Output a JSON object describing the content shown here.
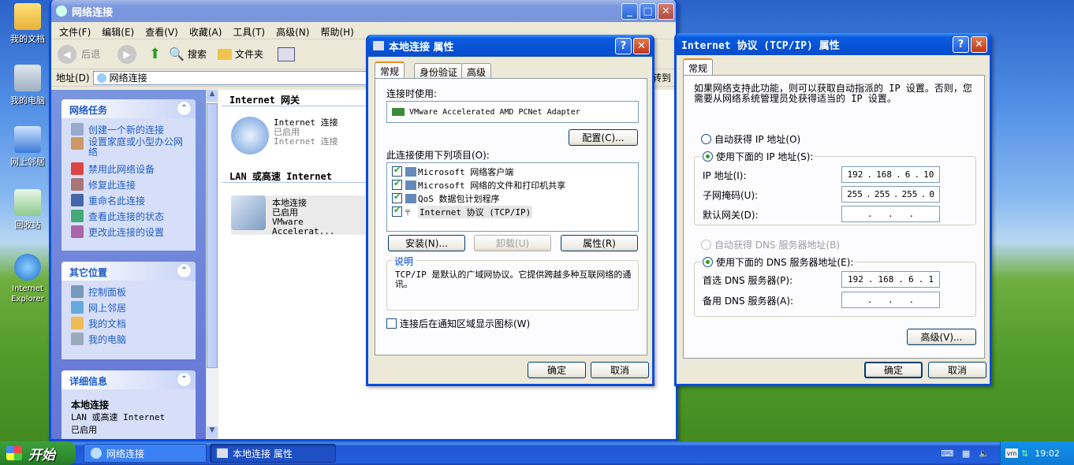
{
  "desktop": {
    "icons": [
      "我的文档",
      "我的电脑",
      "网上邻居",
      "回收站",
      "Internet Explorer"
    ]
  },
  "explorer": {
    "title": "网络连接",
    "menu": [
      "文件(F)",
      "编辑(E)",
      "查看(V)",
      "收藏(A)",
      "工具(T)",
      "高级(N)",
      "帮助(H)"
    ],
    "toolbar": {
      "back": "后退",
      "search": "搜索",
      "folders": "文件夹"
    },
    "address": {
      "label": "地址(D)",
      "value": "网络连接",
      "go": "转到"
    },
    "network_tasks": {
      "title": "网络任务",
      "items": [
        "创建一个新的连接",
        "设置家庭或小型办公网络",
        "禁用此网络设备",
        "修复此连接",
        "重命名此连接",
        "查看此连接的状态",
        "更改此连接的设置"
      ]
    },
    "other_places": {
      "title": "其它位置",
      "items": [
        "控制面板",
        "网上邻居",
        "我的文档",
        "我的电脑"
      ]
    },
    "details": {
      "title": "详细信息",
      "name": "本地连接",
      "type": "LAN 或高速 Internet",
      "status": "已启用"
    },
    "groups": {
      "gateway": "Internet 网关",
      "lan": "LAN 或高速 Internet"
    },
    "gateway_item": {
      "name": "Internet 连接",
      "status": "已启用",
      "sub": "Internet 连接"
    },
    "lan_item": {
      "name": "本地连接",
      "status": "已启用",
      "device": "VMware Accelerat..."
    }
  },
  "props": {
    "title": "本地连接 属性",
    "tabs": [
      "常规",
      "身份验证",
      "高级"
    ],
    "connect_using_label": "连接时使用:",
    "adapter": "VMware Accelerated AMD PCNet Adapter",
    "configure_btn": "配置(C)...",
    "items_label": "此连接使用下列项目(O):",
    "items": [
      "Microsoft 网络客户端",
      "Microsoft 网络的文件和打印机共享",
      "QoS 数据包计划程序",
      "Internet 协议 (TCP/IP)"
    ],
    "install_btn": "安装(N)...",
    "uninstall_btn": "卸载(U)",
    "properties_btn": "属性(R)",
    "desc_title": "说明",
    "desc_text": "TCP/IP 是默认的广域网协议。它提供跨越多种互联网络的通讯。",
    "notify_label": "连接后在通知区域显示图标(W)",
    "ok": "确定",
    "cancel": "取消"
  },
  "tcpip": {
    "title": "Internet 协议 (TCP/IP) 属性",
    "tab": "常规",
    "intro": "如果网络支持此功能，则可以获取自动指派的 IP 设置。否则，您需要从网络系统管理员处获得适当的 IP 设置。",
    "auto_ip": "自动获得 IP 地址(O)",
    "manual_ip": "使用下面的 IP 地址(S):",
    "ip_label": "IP 地址(I):",
    "ip": [
      "192",
      "168",
      "6",
      "10"
    ],
    "mask_label": "子网掩码(U):",
    "mask": [
      "255",
      "255",
      "255",
      "0"
    ],
    "gw_label": "默认网关(D):",
    "gw": [
      ".",
      ".",
      "."
    ],
    "auto_dns": "自动获得 DNS 服务器地址(B)",
    "manual_dns": "使用下面的 DNS 服务器地址(E):",
    "dns1_label": "首选 DNS 服务器(P):",
    "dns1": [
      "192",
      "168",
      "6",
      "1"
    ],
    "dns2_label": "备用 DNS 服务器(A):",
    "dns2": [
      ".",
      ".",
      "."
    ],
    "advanced_btn": "高级(V)...",
    "ok": "确定",
    "cancel": "取消"
  },
  "taskbar": {
    "start": "开始",
    "tasks": [
      "网络连接",
      "本地连接 属性"
    ],
    "clock": "19:02"
  }
}
